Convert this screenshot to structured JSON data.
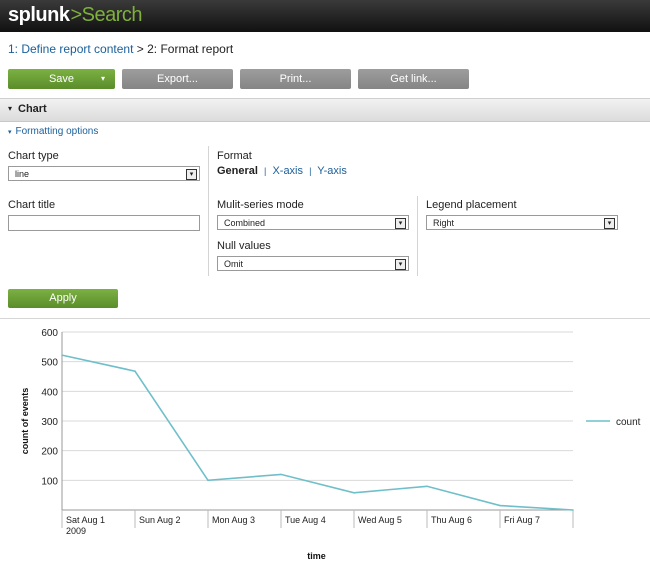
{
  "app": {
    "logo": "splunk",
    "logo_arrow": ">",
    "app_name": "Search"
  },
  "breadcrumb": {
    "step1": "1: Define report content",
    "separator": ">",
    "step2": "2: Format report"
  },
  "toolbar": {
    "save_label": "Save",
    "save_caret": "▾",
    "export_label": "Export...",
    "print_label": "Print...",
    "getlink_label": "Get link..."
  },
  "section": {
    "caret": "▾",
    "title": "Chart"
  },
  "formatting": {
    "caret": "▾",
    "label": "Formatting options"
  },
  "form": {
    "chart_type_label": "Chart type",
    "chart_type_value": "line",
    "chart_title_label": "Chart title",
    "chart_title_value": "",
    "format_label": "Format",
    "format_tabs": {
      "general": "General",
      "sep": "|",
      "xaxis": "X-axis",
      "yaxis": "Y-axis"
    },
    "multiseries_label": "Mulit-series mode",
    "multiseries_value": "Combined",
    "null_values_label": "Null values",
    "null_values_value": "Omit",
    "legend_label": "Legend placement",
    "legend_value": "Right",
    "dropdown_arrow": "▾"
  },
  "apply_label": "Apply",
  "chart_data": {
    "type": "line",
    "title": "",
    "xlabel": "time",
    "ylabel": "count of events",
    "categories": [
      "Sat Aug 1 2009",
      "Sun Aug 2",
      "Mon Aug 3",
      "Tue Aug 4",
      "Wed Aug 5",
      "Thu Aug 6",
      "Fri Aug 7"
    ],
    "category_lines": [
      [
        "Sat Aug 1",
        "2009"
      ],
      [
        "Sun Aug 2"
      ],
      [
        "Mon Aug 3"
      ],
      [
        "Tue Aug 4"
      ],
      [
        "Wed Aug 5"
      ],
      [
        "Thu Aug 6"
      ],
      [
        "Fri Aug 7"
      ]
    ],
    "x_points": [
      0,
      1,
      2,
      3,
      4,
      5,
      6,
      7
    ],
    "series": [
      {
        "name": "count",
        "values": [
          522,
          468,
          100,
          120,
          58,
          80,
          15,
          0
        ],
        "color": "#6fbfca"
      }
    ],
    "ylim": [
      0,
      600
    ],
    "yticks": [
      100,
      200,
      300,
      400,
      500,
      600
    ],
    "grid": true,
    "legend": "right"
  }
}
